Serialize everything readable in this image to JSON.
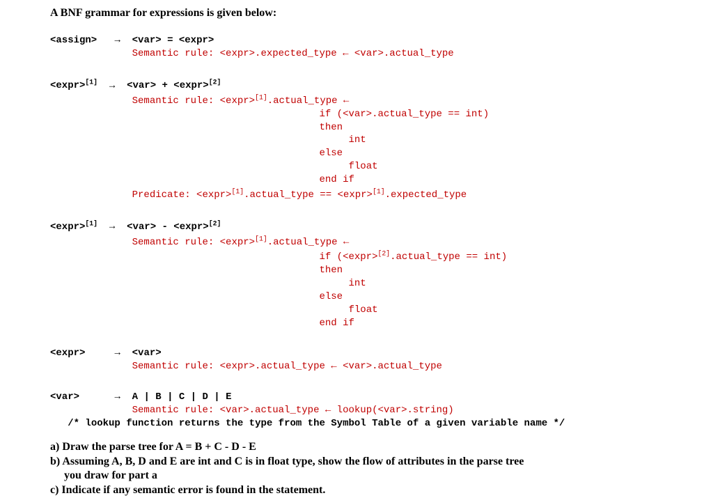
{
  "title": "A BNF grammar for expressions is given below:",
  "rules": {
    "assign": {
      "lhs": "<assign>",
      "arrow": "→",
      "rhs": "<var> = <expr>",
      "sem": "Semantic rule: <expr>.expected_type ",
      "larrow": "←",
      "sem2": " <var>.actual_type"
    },
    "expr1": {
      "lhs": "<expr>",
      "sup": "[1]",
      "arrow": "→",
      "rhs1": "<var> + <expr>",
      "sup2": "[2]",
      "sem_lead": "Semantic rule: <expr>",
      "sem_sup": "[1]",
      "sem_tail": ".actual_type ",
      "larrow": "←",
      "if_line": "if (<var>.actual_type == int)",
      "then": "then",
      "int": "int",
      "else": "else",
      "float": "float",
      "endif": "end if",
      "pred_lead": "Predicate: <expr>",
      "pred_s1": "[1]",
      "pred_mid": ".actual_type == <expr>",
      "pred_s2": "[1]",
      "pred_tail": ".expected_type"
    },
    "expr2": {
      "lhs": "<expr>",
      "sup": "[1]",
      "arrow": "→",
      "rhs1": "<var> - <expr>",
      "sup2": "[2]",
      "sem_lead": "Semantic rule: <expr>",
      "sem_sup": "[1]",
      "sem_tail": ".actual_type ",
      "larrow": "←",
      "if_lead": "if (<expr>",
      "if_sup": "[2]",
      "if_tail": ".actual_type == int)",
      "then": "then",
      "int": "int",
      "else": "else",
      "float": "float",
      "endif": "end if"
    },
    "expr3": {
      "lhs": "<expr>",
      "arrow": "→",
      "rhs": "<var>",
      "sem": "Semantic rule: <expr>.actual_type ",
      "larrow": "←",
      "sem2": " <var>.actual_type"
    },
    "var": {
      "lhs": "<var>",
      "arrow": "→",
      "rhs": "A | B | C | D | E",
      "sem": "Semantic rule: <var>.actual_type ",
      "larrow": "←",
      "sem2": " lookup(<var>.string)",
      "comment": "/* lookup function returns the type from the Symbol Table of a given variable name */"
    }
  },
  "q": {
    "a1": "a) Draw the parse tree for       A = B + C - D - E",
    "b1": "b) Assuming A, B, D and E are int and C is in float type, show the flow of attributes in the parse tree",
    "b2": "you draw for part a",
    "c1": "c) Indicate if any semantic error is found in the statement."
  }
}
